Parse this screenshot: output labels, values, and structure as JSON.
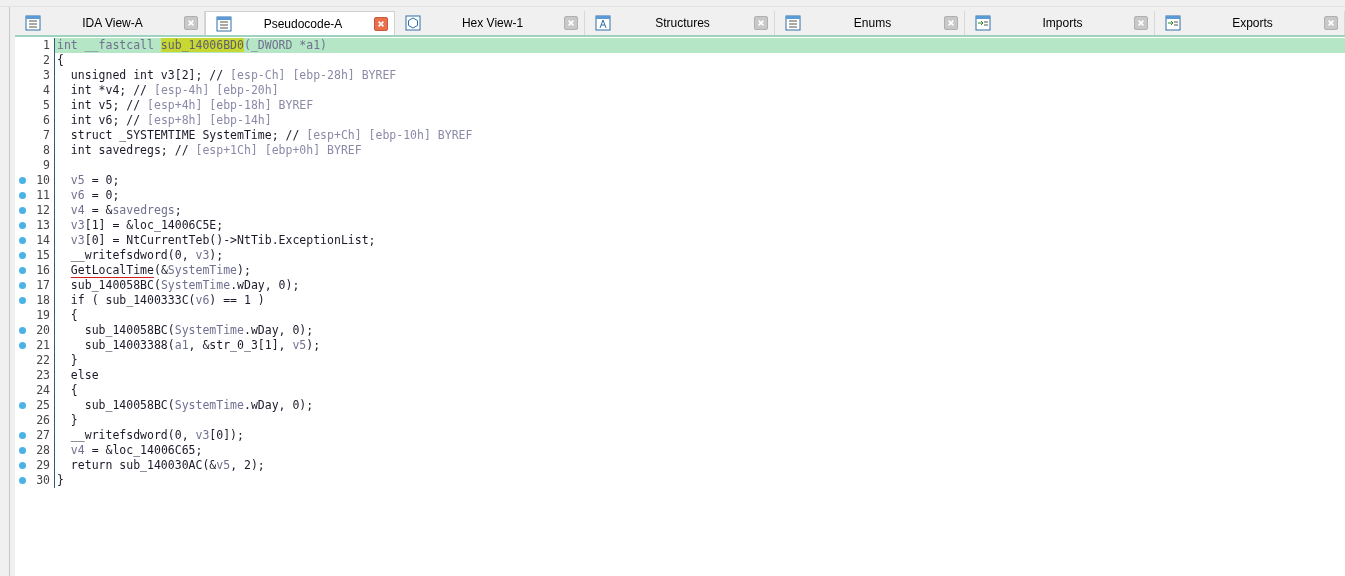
{
  "tabs": [
    {
      "label": "IDA View-A",
      "selected": false
    },
    {
      "label": "Pseudocode-A",
      "selected": true
    },
    {
      "label": "Hex View-1",
      "selected": false
    },
    {
      "label": "Structures",
      "selected": false
    },
    {
      "label": "Enums",
      "selected": false
    },
    {
      "label": "Imports",
      "selected": false
    },
    {
      "label": "Exports",
      "selected": false
    }
  ],
  "lines": [
    {
      "number": "1",
      "dot": false,
      "current": true,
      "segments": [
        {
          "text": "int __fastcall ",
          "kind": "var"
        },
        {
          "text": "sub_14006BD0",
          "kind": "highlight"
        },
        {
          "text": "(_DWORD *a1)",
          "kind": "var"
        }
      ]
    },
    {
      "number": "2",
      "dot": false,
      "current": false,
      "segments": [
        {
          "text": "{",
          "kind": "code"
        }
      ]
    },
    {
      "number": "3",
      "dot": false,
      "current": false,
      "segments": [
        {
          "text": "  unsigned int v3[2]; // ",
          "kind": "code"
        },
        {
          "text": "[esp-Ch] [ebp-28h] BYREF",
          "kind": "comment"
        }
      ]
    },
    {
      "number": "4",
      "dot": false,
      "current": false,
      "segments": [
        {
          "text": "  int *v4; // ",
          "kind": "code"
        },
        {
          "text": "[esp-4h] [ebp-20h]",
          "kind": "comment"
        }
      ]
    },
    {
      "number": "5",
      "dot": false,
      "current": false,
      "segments": [
        {
          "text": "  int v5; // ",
          "kind": "code"
        },
        {
          "text": "[esp+4h] [ebp-18h] BYREF",
          "kind": "comment"
        }
      ]
    },
    {
      "number": "6",
      "dot": false,
      "current": false,
      "segments": [
        {
          "text": "  int v6; // ",
          "kind": "code"
        },
        {
          "text": "[esp+8h] [ebp-14h]",
          "kind": "comment"
        }
      ]
    },
    {
      "number": "7",
      "dot": false,
      "current": false,
      "segments": [
        {
          "text": "  struct _SYSTEMTIME SystemTime; // ",
          "kind": "code"
        },
        {
          "text": "[esp+Ch] [ebp-10h] BYREF",
          "kind": "comment"
        }
      ]
    },
    {
      "number": "8",
      "dot": false,
      "current": false,
      "segments": [
        {
          "text": "  int savedregs; // ",
          "kind": "code"
        },
        {
          "text": "[esp+1Ch] [ebp+0h] BYREF",
          "kind": "comment"
        }
      ]
    },
    {
      "number": "9",
      "dot": false,
      "current": false
    },
    {
      "number": "10",
      "dot": true,
      "current": false,
      "segments": [
        {
          "text": "  v5",
          "kind": "var"
        },
        {
          "text": " = 0;",
          "kind": "code"
        }
      ]
    },
    {
      "number": "11",
      "dot": true,
      "current": false,
      "segments": [
        {
          "text": "  v6",
          "kind": "var"
        },
        {
          "text": " = 0;",
          "kind": "code"
        }
      ]
    },
    {
      "number": "12",
      "dot": true,
      "current": false,
      "segments": [
        {
          "text": "  v4",
          "kind": "var"
        },
        {
          "text": " = &",
          "kind": "code"
        },
        {
          "text": "savedregs",
          "kind": "var"
        },
        {
          "text": ";",
          "kind": "code"
        }
      ]
    },
    {
      "number": "13",
      "dot": true,
      "current": false,
      "segments": [
        {
          "text": "  v3",
          "kind": "var"
        },
        {
          "text": "[1] = &loc_14006C5E;",
          "kind": "code"
        }
      ]
    },
    {
      "number": "14",
      "dot": true,
      "current": false,
      "segments": [
        {
          "text": "  v3",
          "kind": "var"
        },
        {
          "text": "[0] = NtCurrentTeb()->NtTib.ExceptionList;",
          "kind": "code"
        }
      ]
    },
    {
      "number": "15",
      "dot": true,
      "current": false,
      "segments": [
        {
          "text": "  __writefsdword(0, ",
          "kind": "code"
        },
        {
          "text": "v3",
          "kind": "var"
        },
        {
          "text": ");",
          "kind": "code"
        }
      ]
    },
    {
      "number": "16",
      "dot": true,
      "current": false,
      "segments": [
        {
          "text": "  GetLocalTime",
          "kind": "underline"
        },
        {
          "text": "(&",
          "kind": "code"
        },
        {
          "text": "SystemTime",
          "kind": "var"
        },
        {
          "text": ");",
          "kind": "code"
        }
      ]
    },
    {
      "number": "17",
      "dot": true,
      "current": false,
      "segments": [
        {
          "text": "  sub_140058BC(",
          "kind": "code"
        },
        {
          "text": "SystemTime",
          "kind": "var"
        },
        {
          "text": ".wDay, 0);",
          "kind": "code"
        }
      ]
    },
    {
      "number": "18",
      "dot": true,
      "current": false,
      "segments": [
        {
          "text": "  if ( sub_1400333C(",
          "kind": "code"
        },
        {
          "text": "v6",
          "kind": "var"
        },
        {
          "text": ") == 1 )",
          "kind": "code"
        }
      ]
    },
    {
      "number": "19",
      "dot": false,
      "current": false,
      "segments": [
        {
          "text": "  {",
          "kind": "code"
        }
      ]
    },
    {
      "number": "20",
      "dot": true,
      "current": false,
      "segments": [
        {
          "text": "    sub_140058BC(",
          "kind": "code"
        },
        {
          "text": "SystemTime",
          "kind": "var"
        },
        {
          "text": ".wDay, 0);",
          "kind": "code"
        }
      ]
    },
    {
      "number": "21",
      "dot": true,
      "current": false,
      "segments": [
        {
          "text": "    sub_14003388(",
          "kind": "code"
        },
        {
          "text": "a1",
          "kind": "var"
        },
        {
          "text": ", &str_0_3[1], ",
          "kind": "code"
        },
        {
          "text": "v5",
          "kind": "var"
        },
        {
          "text": ");",
          "kind": "code"
        }
      ]
    },
    {
      "number": "22",
      "dot": false,
      "current": false,
      "segments": [
        {
          "text": "  }",
          "kind": "code"
        }
      ]
    },
    {
      "number": "23",
      "dot": false,
      "current": false,
      "segments": [
        {
          "text": "  else",
          "kind": "code"
        }
      ]
    },
    {
      "number": "24",
      "dot": false,
      "current": false,
      "segments": [
        {
          "text": "  {",
          "kind": "code"
        }
      ]
    },
    {
      "number": "25",
      "dot": true,
      "current": false,
      "segments": [
        {
          "text": "    sub_140058BC(",
          "kind": "code"
        },
        {
          "text": "SystemTime",
          "kind": "var"
        },
        {
          "text": ".wDay, 0);",
          "kind": "code"
        }
      ]
    },
    {
      "number": "26",
      "dot": false,
      "current": false,
      "segments": [
        {
          "text": "  }",
          "kind": "code"
        }
      ]
    },
    {
      "number": "27",
      "dot": true,
      "current": false,
      "segments": [
        {
          "text": "  __writefsdword(0, ",
          "kind": "code"
        },
        {
          "text": "v3",
          "kind": "var"
        },
        {
          "text": "[0]);",
          "kind": "code"
        }
      ]
    },
    {
      "number": "28",
      "dot": true,
      "current": false,
      "segments": [
        {
          "text": "  v4",
          "kind": "var"
        },
        {
          "text": " = &loc_14006C65;",
          "kind": "code"
        }
      ]
    },
    {
      "number": "29",
      "dot": true,
      "current": false,
      "segments": [
        {
          "text": "  return sub_140030AC(&",
          "kind": "code"
        },
        {
          "text": "v5",
          "kind": "var"
        },
        {
          "text": ", 2);",
          "kind": "code"
        }
      ]
    },
    {
      "number": "30",
      "dot": true,
      "current": false,
      "segments": [
        {
          "text": "}",
          "kind": "code"
        }
      ]
    }
  ]
}
